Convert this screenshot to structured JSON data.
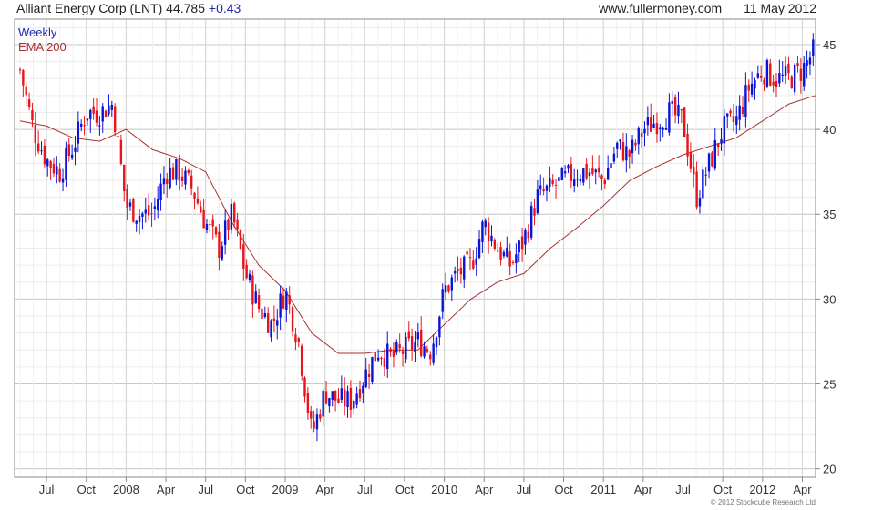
{
  "header": {
    "title": "Alliant Energy Corp (LNT) 44.785",
    "change": "+0.43",
    "site": "www.fullermoney.com",
    "date": "11 May 2012"
  },
  "legend": {
    "period": "Weekly",
    "ema": "EMA 200",
    "period_color": "#1f2bb0",
    "ema_color": "#a83232"
  },
  "copyright": "© 2012 Stockcube Research Ltd",
  "colors": {
    "up": "#0a14d6",
    "down": "#e8141a",
    "ema": "#a83232",
    "grid": "#d8d8d8",
    "frame": "#888888"
  },
  "chart_data": {
    "type": "line",
    "subtype": "candlestick",
    "title": "Alliant Energy Corp (LNT) 44.785",
    "xlabel": "",
    "ylabel": "",
    "ylim": [
      19.5,
      46.5
    ],
    "yticks": [
      20,
      25,
      30,
      35,
      40,
      45
    ],
    "y_axis_side": "right",
    "grid": true,
    "legend_position": "top-left",
    "xticks": [
      "Jul",
      "Oct",
      "2008",
      "Apr",
      "Jul",
      "Oct",
      "2009",
      "Apr",
      "Jul",
      "Oct",
      "2010",
      "Apr",
      "Jul",
      "Oct",
      "2011",
      "Apr",
      "Jul",
      "Oct",
      "2012",
      "Apr"
    ],
    "series": [
      {
        "name": "Weekly",
        "kind": "candlestick_close",
        "x": [
          "2007-05",
          "2007-06",
          "2007-07",
          "2007-08",
          "2007-09",
          "2007-10",
          "2007-11",
          "2007-12",
          "2008-01",
          "2008-02",
          "2008-03",
          "2008-04",
          "2008-05",
          "2008-06",
          "2008-07",
          "2008-08",
          "2008-09",
          "2008-10",
          "2008-11",
          "2008-12",
          "2009-01",
          "2009-02",
          "2009-03",
          "2009-04",
          "2009-05",
          "2009-06",
          "2009-07",
          "2009-08",
          "2009-09",
          "2009-10",
          "2009-11",
          "2009-12",
          "2010-01",
          "2010-02",
          "2010-03",
          "2010-04",
          "2010-05",
          "2010-06",
          "2010-07",
          "2010-08",
          "2010-09",
          "2010-10",
          "2010-11",
          "2010-12",
          "2011-01",
          "2011-02",
          "2011-03",
          "2011-04",
          "2011-05",
          "2011-06",
          "2011-07",
          "2011-08",
          "2011-09",
          "2011-10",
          "2011-11",
          "2011-12",
          "2012-01",
          "2012-02",
          "2012-03",
          "2012-04",
          "2012-05"
        ],
        "values": [
          43.5,
          40.0,
          38.2,
          37.5,
          39.0,
          41.0,
          41.0,
          41.5,
          35.5,
          35.0,
          35.0,
          37.5,
          37.5,
          36.5,
          34.5,
          33.0,
          35.0,
          31.5,
          29.5,
          28.5,
          30.5,
          27.5,
          22.0,
          24.5,
          24.0,
          24.0,
          25.5,
          27.0,
          26.5,
          27.0,
          27.5,
          27.0,
          30.5,
          31.5,
          32.0,
          34.5,
          33.0,
          32.0,
          33.5,
          36.0,
          36.5,
          37.0,
          37.5,
          37.5,
          37.0,
          39.0,
          38.5,
          40.0,
          40.5,
          41.0,
          40.5,
          36.0,
          38.0,
          40.0,
          40.5,
          42.5,
          43.5,
          43.0,
          43.0,
          43.5,
          44.785
        ]
      },
      {
        "name": "EMA 200",
        "kind": "line",
        "x": [
          "2007-05",
          "2007-07",
          "2007-09",
          "2007-11",
          "2008-01",
          "2008-03",
          "2008-05",
          "2008-07",
          "2008-09",
          "2008-11",
          "2009-01",
          "2009-03",
          "2009-05",
          "2009-07",
          "2009-09",
          "2009-11",
          "2010-01",
          "2010-03",
          "2010-05",
          "2010-07",
          "2010-09",
          "2010-11",
          "2011-01",
          "2011-03",
          "2011-05",
          "2011-07",
          "2011-09",
          "2011-11",
          "2012-01",
          "2012-03",
          "2012-05"
        ],
        "values": [
          40.5,
          40.2,
          39.5,
          39.3,
          40.0,
          38.8,
          38.3,
          37.5,
          34.5,
          32.0,
          30.5,
          28.0,
          26.8,
          26.8,
          27.0,
          27.0,
          28.5,
          30.0,
          31.0,
          31.5,
          33.0,
          34.2,
          35.5,
          37.0,
          37.8,
          38.5,
          39.0,
          39.5,
          40.5,
          41.5,
          42.0
        ]
      }
    ]
  }
}
